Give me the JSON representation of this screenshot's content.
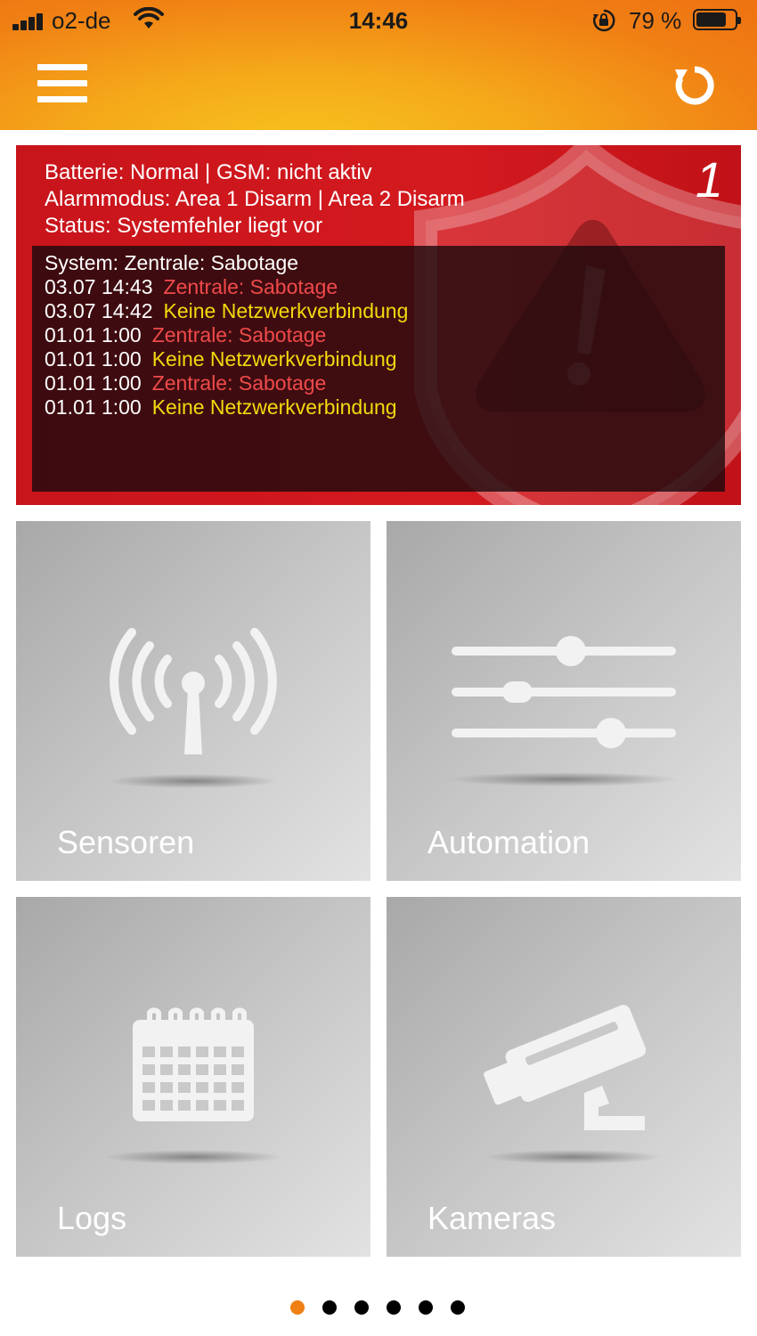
{
  "status_bar": {
    "carrier": "o2-de",
    "time": "14:46",
    "battery_percent": "79 %",
    "battery_level": 0.79
  },
  "header": {
    "menu_icon": "hamburger-menu-icon",
    "refresh_icon": "refresh-icon"
  },
  "alarm_panel": {
    "number": "1",
    "info_lines": [
      "Batterie: Normal | GSM: nicht aktiv",
      "Alarmmodus: Area 1 Disarm | Area 2 Disarm",
      "Status: Systemfehler liegt vor"
    ],
    "system_line": "System: Zentrale: Sabotage",
    "log_entries": [
      {
        "date": "03.07 14:43",
        "message": "Zentrale: Sabotage",
        "color": "#f04a4a"
      },
      {
        "date": "03.07 14:42",
        "message": "Keine Netzwerkverbindung",
        "color": "#f4d90f"
      },
      {
        "date": "01.01 1:00",
        "message": "Zentrale: Sabotage",
        "color": "#f04a4a"
      },
      {
        "date": "01.01 1:00",
        "message": "Keine Netzwerkverbindung",
        "color": "#f4d90f"
      },
      {
        "date": "01.01 1:00",
        "message": "Zentrale: Sabotage",
        "color": "#f04a4a"
      },
      {
        "date": "01.01 1:00",
        "message": "Keine Netzwerkverbindung",
        "color": "#f4d90f"
      }
    ],
    "background_color": "#d31a1f"
  },
  "tiles": [
    {
      "label": "Sensoren",
      "icon": "antenna-signal-icon"
    },
    {
      "label": "Automation",
      "icon": "sliders-icon"
    },
    {
      "label": "Logs",
      "icon": "calendar-icon"
    },
    {
      "label": "Kameras",
      "icon": "security-camera-icon"
    }
  ],
  "pagination": {
    "total": 6,
    "active_index": 0,
    "active_color": "#f07f14"
  }
}
